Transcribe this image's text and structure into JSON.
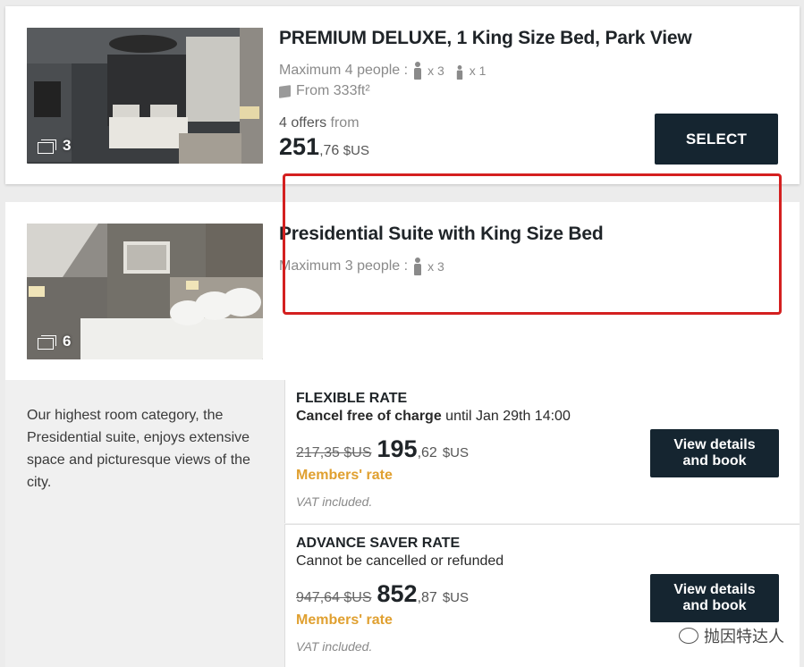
{
  "rooms": [
    {
      "title": "PREMIUM DELUXE, 1 King Size Bed, Park View",
      "photo_count": "3",
      "capacity_label": "Maximum 4 people :",
      "adults": "x 3",
      "children": "x 1",
      "area": "From 333ft²",
      "offers": "4 offers",
      "from_label": "from",
      "price_int": "251",
      "price_dec": ",76",
      "currency": "$US",
      "select_label": "SELECT"
    },
    {
      "title": "Presidential Suite with King Size Bed",
      "photo_count": "6",
      "capacity_label": "Maximum 3 people :",
      "adults": "x 3",
      "description": "Our highest room category, the Presidential suite, enjoys extensive space and picturesque views of the city.",
      "rates": [
        {
          "name": "FLEXIBLE RATE",
          "cond_bold": "Cancel free of charge",
          "cond_rest": " until Jan 29th 14:00",
          "old_price": "217,35 $US",
          "price_int": "195",
          "price_dec": ",62",
          "currency": "$US",
          "members": "Members' rate",
          "vat": "VAT included.",
          "button": "View details and book"
        },
        {
          "name": "ADVANCE SAVER RATE",
          "cond_bold": "",
          "cond_rest": "Cannot be cancelled or refunded",
          "old_price": "947,64 $US",
          "price_int": "852",
          "price_dec": ",87",
          "currency": "$US",
          "members": "Members' rate",
          "vat": "VAT included.",
          "button": "View details and book"
        }
      ]
    }
  ],
  "watermark": "抛因特达人",
  "colors": {
    "button_bg": "#152530",
    "members_rate": "#e0a030",
    "highlight_border": "#d42020"
  }
}
